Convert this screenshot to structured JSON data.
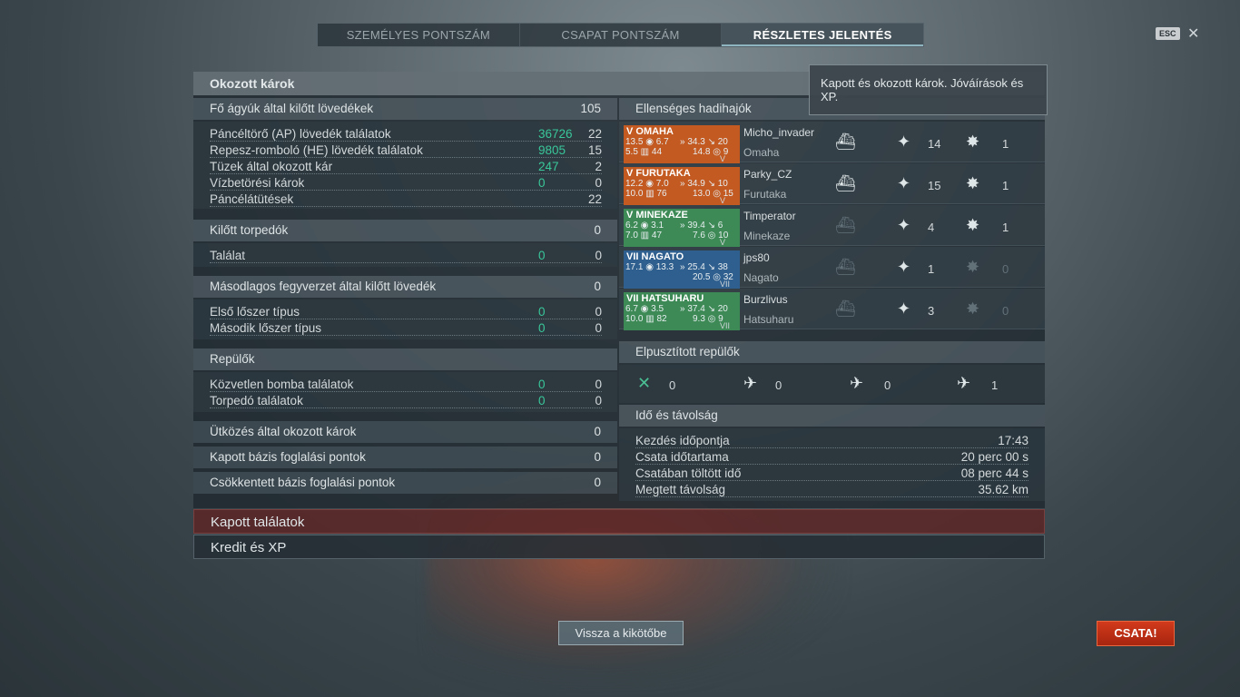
{
  "tabs": [
    {
      "label": "SZEMÉLYES PONTSZÁM"
    },
    {
      "label": "CSAPAT PONTSZÁM"
    },
    {
      "label": "RÉSZLETES JELENTÉS"
    }
  ],
  "esc_label": "ESC",
  "close_glyph": "✕",
  "tooltip": "Kapott és okozott károk. Jóváírások és XP.",
  "left": {
    "header": "Okozott károk",
    "main_guns": {
      "label": "Fő ágyúk által kilőtt lövedékek",
      "value": "105"
    },
    "main_rows": [
      {
        "label": "Páncéltörő (AP) lövedék találatok",
        "dmg": "36726",
        "count": "22"
      },
      {
        "label": "Repesz-romboló (HE) lövedék találatok",
        "dmg": "9805",
        "count": "15"
      },
      {
        "label": "Tüzek által okozott kár",
        "dmg": "247",
        "count": "2"
      },
      {
        "label": "Vízbetörési károk",
        "dmg": "0",
        "count": "0"
      },
      {
        "label": "Páncélátütések",
        "dmg": "",
        "count": "22"
      }
    ],
    "torpedoes": {
      "label": "Kilőtt torpedók",
      "value": "0"
    },
    "torp_hit": {
      "label": "Találat",
      "dmg": "0",
      "count": "0"
    },
    "secondary": {
      "label": "Másodlagos fegyverzet által kilőtt lövedék",
      "value": "0"
    },
    "secondary_rows": [
      {
        "label": "Első lőszer típus",
        "dmg": "0",
        "count": "0"
      },
      {
        "label": "Második lőszer típus",
        "dmg": "0",
        "count": "0"
      }
    ],
    "planes": {
      "label": "Repülők",
      "value": ""
    },
    "plane_rows": [
      {
        "label": "Közvetlen bomba találatok",
        "dmg": "0",
        "count": "0"
      },
      {
        "label": "Torpedó találatok",
        "dmg": "0",
        "count": "0"
      }
    ],
    "ram": {
      "label": "Ütközés által okozott károk",
      "value": "0"
    },
    "cap": {
      "label": "Kapott bázis foglalási pontok",
      "value": "0"
    },
    "defend": {
      "label": "Csökkentett bázis foglalási pontok",
      "value": "0"
    }
  },
  "right": {
    "enemy_header": "Ellenséges hadihajók",
    "ships": [
      {
        "title": "V OMAHA",
        "color": "#c25a22",
        "s1": "13.5 ◉ 6.7",
        "s2": "» 34.3 ↘ 20",
        "s3": "5.5 ▥ 44",
        "s4": "14.8 ◎ 9",
        "tier": "V",
        "player": "Micho_invader",
        "ship": "Omaha",
        "sunk": true,
        "hits": "14",
        "fires": "1",
        "fire_dim": false
      },
      {
        "title": "V FURUTAKA",
        "color": "#c25a22",
        "s1": "12.2 ◉ 7.0",
        "s2": "» 34.9 ↘ 10",
        "s3": "10.0 ▥ 76",
        "s4": "13.0 ◎ 15",
        "tier": "V",
        "player": "Parky_CZ",
        "ship": "Furutaka",
        "sunk": true,
        "hits": "15",
        "fires": "1",
        "fire_dim": false
      },
      {
        "title": "V MINEKAZE",
        "color": "#3d8a56",
        "s1": "6.2 ◉ 3.1",
        "s2": "» 39.4 ↘ 6",
        "s3": "7.0 ▥ 47",
        "s4": "7.6 ◎ 10",
        "tier": "V",
        "player": "Timperator",
        "ship": "Minekaze",
        "sunk": false,
        "hits": "4",
        "fires": "1",
        "fire_dim": false
      },
      {
        "title": "VII NAGATO",
        "color": "#2f5f8e",
        "s1": "17.1 ◉ 13.3",
        "s2": "» 25.4 ↘ 38",
        "s3": "",
        "s4": "20.5 ◎ 32",
        "tier": "VII",
        "player": "jps80",
        "ship": "Nagato",
        "sunk": false,
        "hits": "1",
        "fires": "0",
        "fire_dim": true
      },
      {
        "title": "VII HATSUHARU",
        "color": "#3d8a56",
        "s1": "6.7 ◉ 3.5",
        "s2": "» 37.4 ↘ 20",
        "s3": "10.0 ▥ 82",
        "s4": "9.3 ◎ 9",
        "tier": "VII",
        "player": "Burzlivus",
        "ship": "Hatsuharu",
        "sunk": false,
        "hits": "3",
        "fires": "0",
        "fire_dim": true
      }
    ],
    "planes_header": "Elpusztított repülők",
    "planes": [
      {
        "icon": "fighter-icon",
        "value": "0"
      },
      {
        "icon": "bomber-icon",
        "value": "0"
      },
      {
        "icon": "torpedo-bomber-icon",
        "value": "0"
      },
      {
        "icon": "scout-plane-icon",
        "value": "1"
      }
    ],
    "time_header": "Idő és távolság",
    "time_rows": [
      {
        "label": "Kezdés időpontja",
        "value": "17:43"
      },
      {
        "label": "Csata időtartama",
        "value": "20 perc 00 s"
      },
      {
        "label": "Csatában töltött idő",
        "value": "08 perc 44 s"
      },
      {
        "label": "Megtett távolság",
        "value": "35.62 km"
      }
    ]
  },
  "bars": {
    "received": "Kapott találatok",
    "credits": "Kredit és XP"
  },
  "buttons": {
    "back": "Vissza a kikötőbe",
    "battle": "CSATA!"
  },
  "colors": {
    "accent_green": "#39c79a",
    "battle_red": "#c0301a",
    "received_bar": "#5a2a2a"
  }
}
